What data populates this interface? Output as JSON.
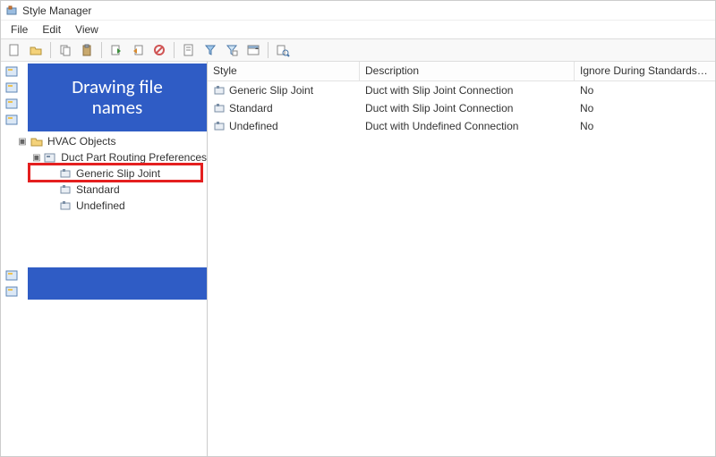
{
  "window": {
    "title": "Style Manager"
  },
  "menubar": {
    "file": "File",
    "edit": "Edit",
    "view": "View"
  },
  "overlay": {
    "label_line1": "Drawing file",
    "label_line2": "names"
  },
  "tree": {
    "hvac_objects": "HVAC Objects",
    "duct_pref": "Duct Part Routing Preferences",
    "generic_slip": "Generic Slip Joint",
    "standard": "Standard",
    "undefined": "Undefined"
  },
  "columns": {
    "style": "Style",
    "description": "Description",
    "ignore": "Ignore During Standards Synchro..."
  },
  "rows": [
    {
      "style": "Generic Slip Joint",
      "description": "Duct with Slip Joint Connection",
      "ignore": "No"
    },
    {
      "style": "Standard",
      "description": "Duct with Slip Joint Connection",
      "ignore": "No"
    },
    {
      "style": "Undefined",
      "description": "Duct with Undefined Connection",
      "ignore": "No"
    }
  ]
}
